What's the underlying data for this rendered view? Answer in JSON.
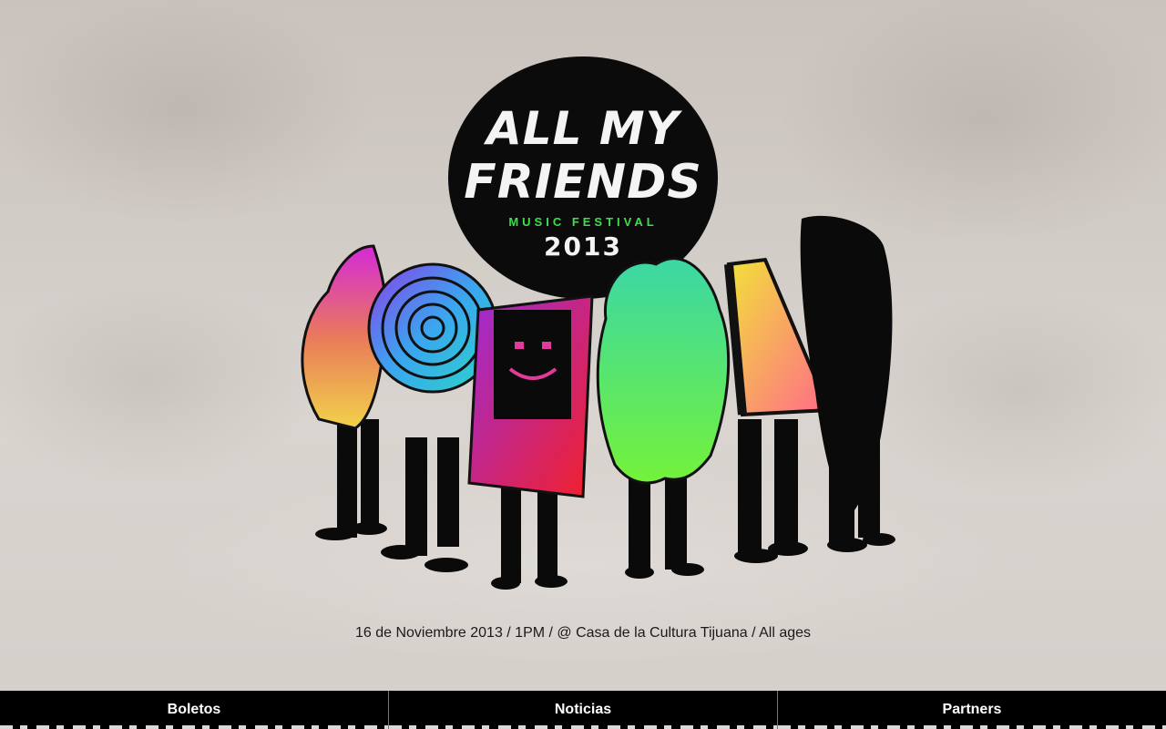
{
  "logo": {
    "line1": "ALL MY",
    "line2": "FRIENDS",
    "subtitle": "MUSIC FESTIVAL",
    "year": "2013"
  },
  "event_info": "16 de Noviembre 2013 / 1PM  / @ Casa de la Cultura Tijuana / All ages",
  "nav": {
    "items": [
      {
        "label": "Boletos"
      },
      {
        "label": "Noticias"
      },
      {
        "label": "Partners"
      }
    ]
  },
  "colors": {
    "navbar_bg": "#000000",
    "logo_bg": "#0b0b0b",
    "subtitle_green": "#39e14a",
    "page_bg": "#cdc7c2"
  }
}
